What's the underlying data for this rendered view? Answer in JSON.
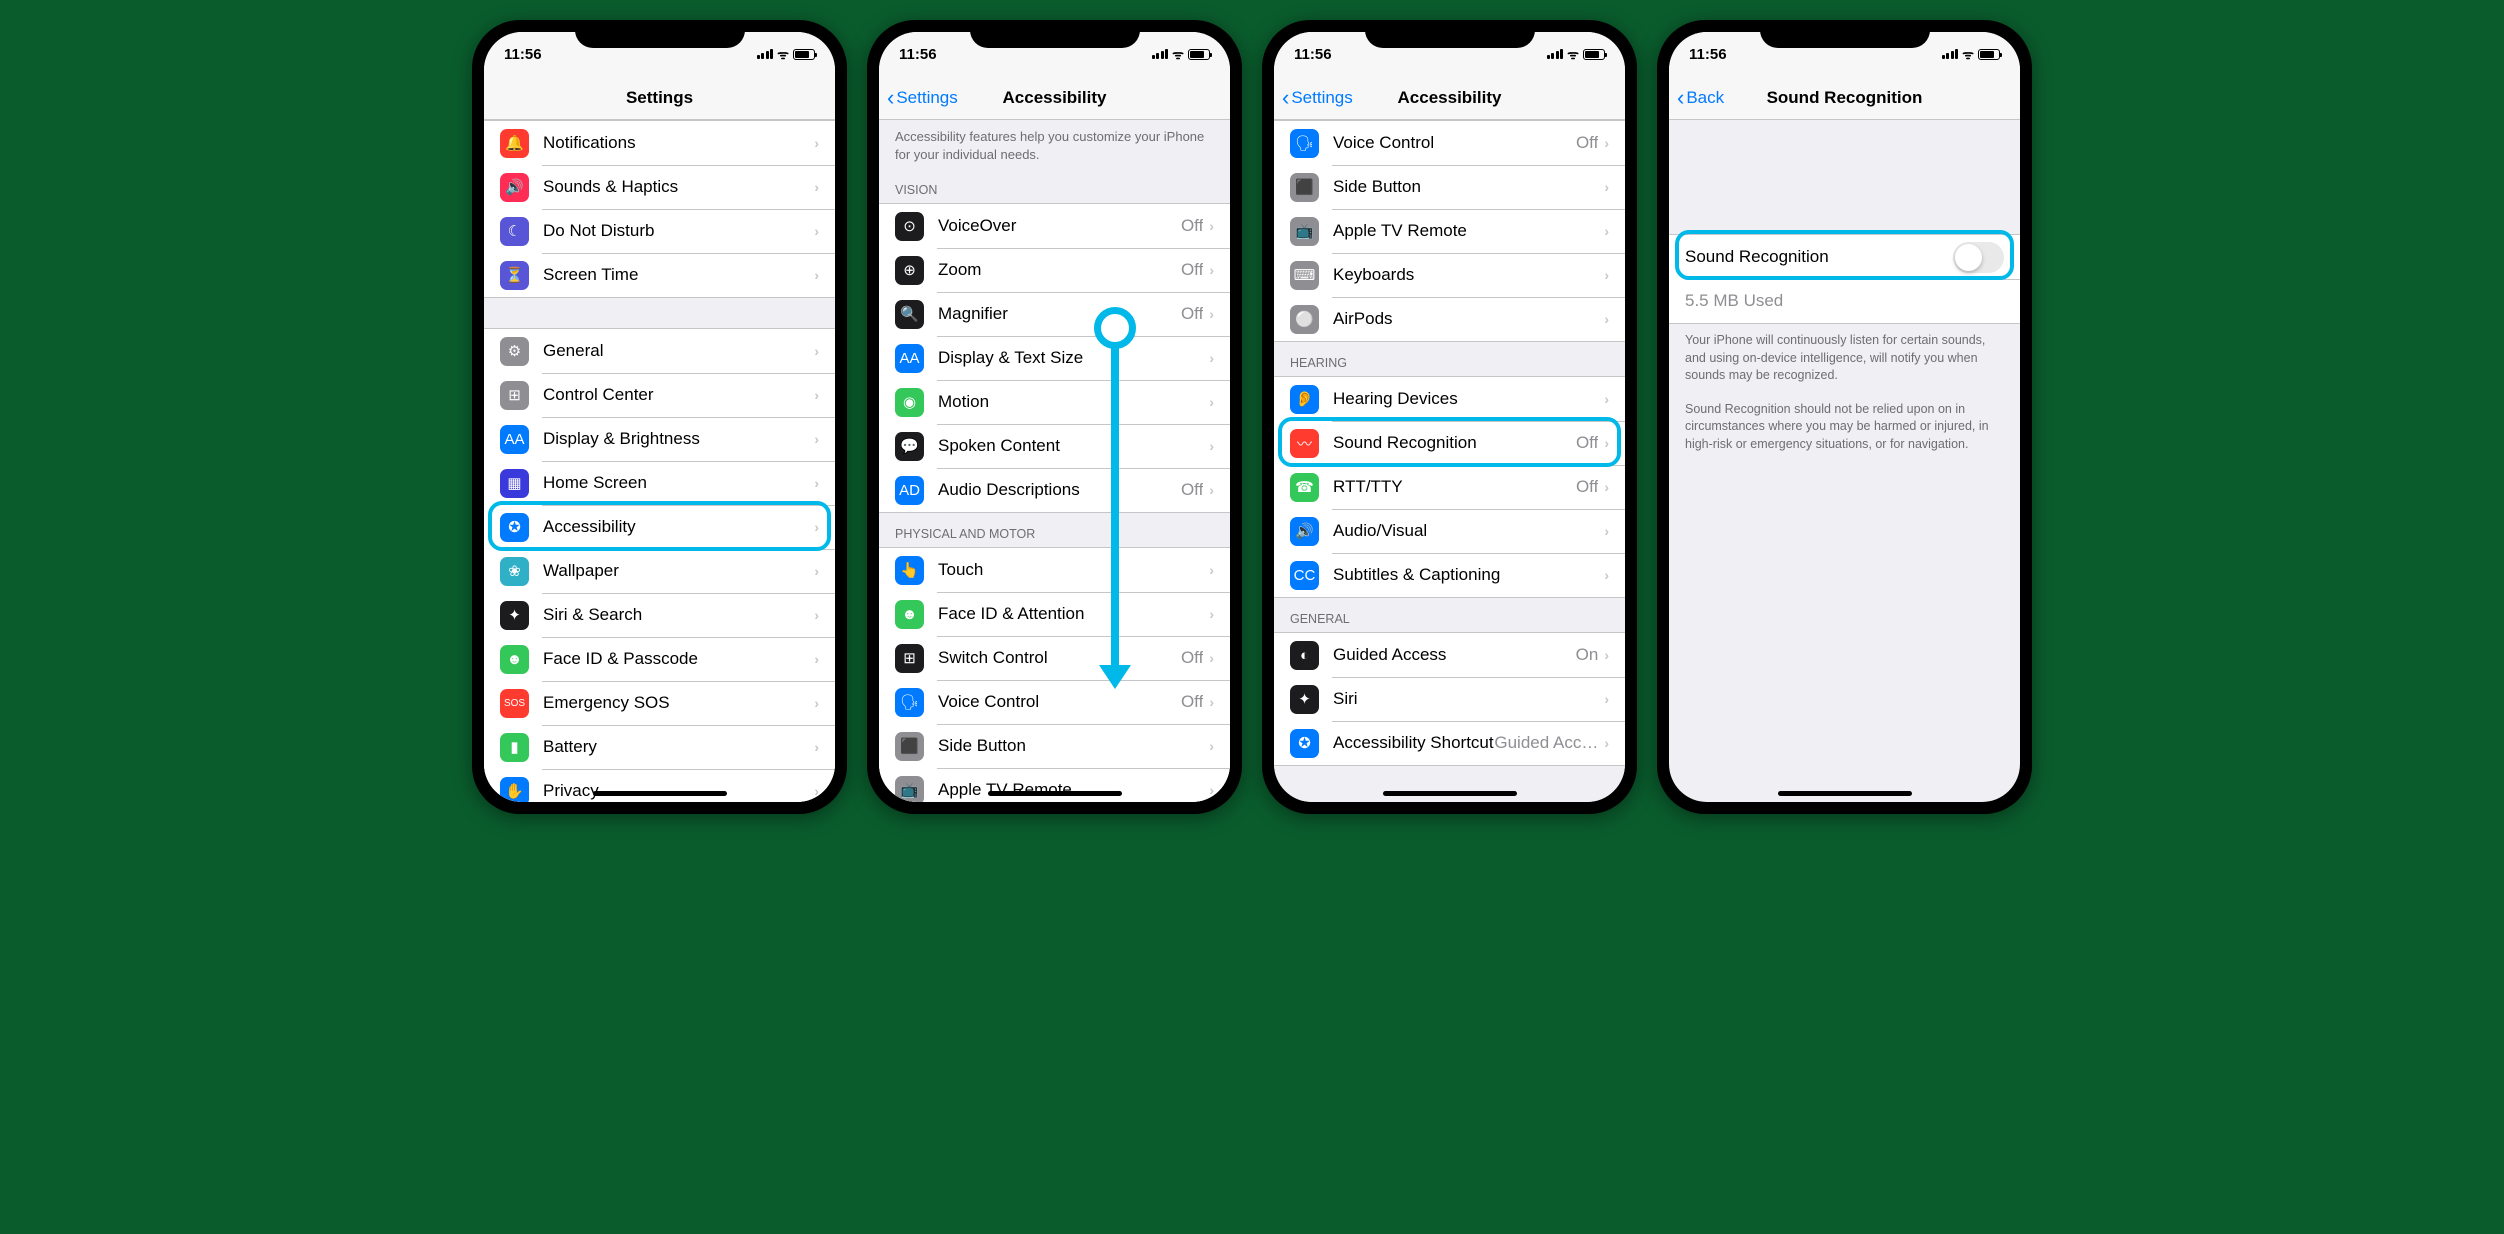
{
  "status": {
    "time": "11:56"
  },
  "screen1": {
    "title": "Settings",
    "group1": [
      {
        "icon": "🔔",
        "bg": "#ff3b30",
        "label": "Notifications"
      },
      {
        "icon": "🔊",
        "bg": "#ff2d55",
        "label": "Sounds & Haptics"
      },
      {
        "icon": "☾",
        "bg": "#5856d6",
        "label": "Do Not Disturb"
      },
      {
        "icon": "⏳",
        "bg": "#5856d6",
        "label": "Screen Time"
      }
    ],
    "group2": [
      {
        "icon": "⚙",
        "bg": "#8e8e93",
        "label": "General"
      },
      {
        "icon": "⊞",
        "bg": "#8e8e93",
        "label": "Control Center"
      },
      {
        "icon": "AA",
        "bg": "#007aff",
        "label": "Display & Brightness"
      },
      {
        "icon": "▦",
        "bg": "#3a3adc",
        "label": "Home Screen"
      },
      {
        "icon": "✪",
        "bg": "#007aff",
        "label": "Accessibility"
      },
      {
        "icon": "❀",
        "bg": "#30b0c7",
        "label": "Wallpaper"
      },
      {
        "icon": "✦",
        "bg": "#1c1c1e",
        "label": "Siri & Search"
      },
      {
        "icon": "☻",
        "bg": "#34c759",
        "label": "Face ID & Passcode"
      },
      {
        "icon": "SOS",
        "bg": "#ff3b30",
        "label": "Emergency SOS"
      },
      {
        "icon": "▮",
        "bg": "#34c759",
        "label": "Battery"
      },
      {
        "icon": "✋",
        "bg": "#007aff",
        "label": "Privacy"
      }
    ]
  },
  "screen2": {
    "back": "Settings",
    "title": "Accessibility",
    "intro": "Accessibility features help you customize your iPhone for your individual needs.",
    "visionHeader": "VISION",
    "vision": [
      {
        "icon": "⊙",
        "bg": "#1c1c1e",
        "label": "VoiceOver",
        "value": "Off"
      },
      {
        "icon": "⊕",
        "bg": "#1c1c1e",
        "label": "Zoom",
        "value": "Off"
      },
      {
        "icon": "🔍",
        "bg": "#1c1c1e",
        "label": "Magnifier",
        "value": "Off"
      },
      {
        "icon": "AA",
        "bg": "#007aff",
        "label": "Display & Text Size",
        "value": ""
      },
      {
        "icon": "◉",
        "bg": "#34c759",
        "label": "Motion",
        "value": ""
      },
      {
        "icon": "💬",
        "bg": "#1c1c1e",
        "label": "Spoken Content",
        "value": ""
      },
      {
        "icon": "AD",
        "bg": "#007aff",
        "label": "Audio Descriptions",
        "value": "Off"
      }
    ],
    "motorHeader": "PHYSICAL AND MOTOR",
    "motor": [
      {
        "icon": "👆",
        "bg": "#007aff",
        "label": "Touch",
        "value": ""
      },
      {
        "icon": "☻",
        "bg": "#34c759",
        "label": "Face ID & Attention",
        "value": ""
      },
      {
        "icon": "⊞",
        "bg": "#1c1c1e",
        "label": "Switch Control",
        "value": "Off"
      },
      {
        "icon": "🗣",
        "bg": "#007aff",
        "label": "Voice Control",
        "value": "Off"
      },
      {
        "icon": "⬛",
        "bg": "#8e8e93",
        "label": "Side Button",
        "value": ""
      },
      {
        "icon": "📺",
        "bg": "#8e8e93",
        "label": "Apple TV Remote",
        "value": ""
      }
    ]
  },
  "screen3": {
    "back": "Settings",
    "title": "Accessibility",
    "motor": [
      {
        "icon": "🗣",
        "bg": "#007aff",
        "label": "Voice Control",
        "value": "Off"
      },
      {
        "icon": "⬛",
        "bg": "#8e8e93",
        "label": "Side Button",
        "value": ""
      },
      {
        "icon": "📺",
        "bg": "#8e8e93",
        "label": "Apple TV Remote",
        "value": ""
      },
      {
        "icon": "⌨",
        "bg": "#8e8e93",
        "label": "Keyboards",
        "value": ""
      },
      {
        "icon": "⚪",
        "bg": "#8e8e93",
        "label": "AirPods",
        "value": ""
      }
    ],
    "hearingHeader": "HEARING",
    "hearing": [
      {
        "icon": "👂",
        "bg": "#007aff",
        "label": "Hearing Devices",
        "value": ""
      },
      {
        "icon": "〰",
        "bg": "#ff3b30",
        "label": "Sound Recognition",
        "value": "Off"
      },
      {
        "icon": "☎",
        "bg": "#34c759",
        "label": "RTT/TTY",
        "value": "Off"
      },
      {
        "icon": "🔊",
        "bg": "#007aff",
        "label": "Audio/Visual",
        "value": ""
      },
      {
        "icon": "CC",
        "bg": "#007aff",
        "label": "Subtitles & Captioning",
        "value": ""
      }
    ],
    "generalHeader": "GENERAL",
    "general": [
      {
        "icon": "◐",
        "bg": "#1c1c1e",
        "label": "Guided Access",
        "value": "On"
      },
      {
        "icon": "✦",
        "bg": "#1c1c1e",
        "label": "Siri",
        "value": ""
      },
      {
        "icon": "✪",
        "bg": "#007aff",
        "label": "Accessibility Shortcut",
        "value": "Guided Acc…"
      }
    ]
  },
  "screen4": {
    "back": "Back",
    "title": "Sound Recognition",
    "toggleLabel": "Sound Recognition",
    "usage": "5.5 MB Used",
    "desc1": "Your iPhone will continuously listen for certain sounds, and using on-device intelligence, will notify you when sounds may be recognized.",
    "desc2": "Sound Recognition should not be relied upon on in circumstances where you may be harmed or injured, in high-risk or emergency situations, or for navigation."
  }
}
